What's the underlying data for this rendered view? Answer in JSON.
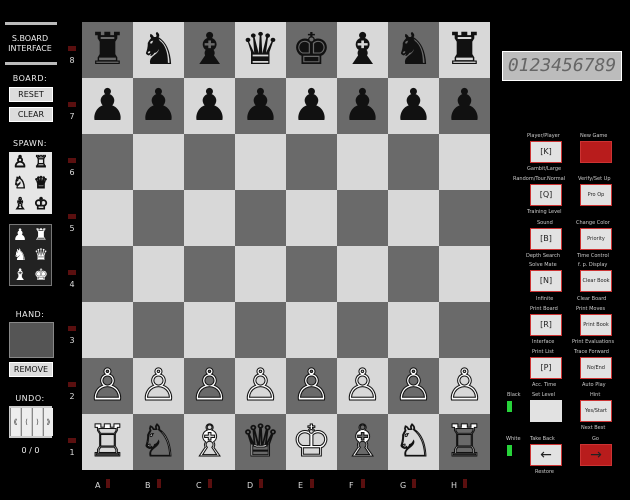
{
  "left_panel": {
    "title_line1": "S.BOARD",
    "title_line2": "INTERFACE",
    "board_label": "BOARD:",
    "reset_label": "RESET",
    "clear_label": "CLEAR",
    "spawn_label": "SPAWN:",
    "spawn_white": [
      "♙",
      "♖",
      "♘",
      "♕",
      "♗",
      "♔"
    ],
    "spawn_black": [
      "♟",
      "♜",
      "♞",
      "♛",
      "♝",
      "♚"
    ],
    "hand_label": "HAND:",
    "remove_label": "REMOVE",
    "undo_label": "UNDO:",
    "undo_buttons": [
      "⟪",
      "⟨",
      "⟩",
      "⟫"
    ],
    "undo_count": "0 / 0"
  },
  "board": {
    "ranks": [
      "8",
      "7",
      "6",
      "5",
      "4",
      "3",
      "2",
      "1"
    ],
    "files": [
      "A",
      "B",
      "C",
      "D",
      "E",
      "F",
      "G",
      "H"
    ],
    "pieces": [
      [
        "♜",
        "♞",
        "♝",
        "♛",
        "♚",
        "♝",
        "♞",
        "♜"
      ],
      [
        "♟",
        "♟",
        "♟",
        "♟",
        "♟",
        "♟",
        "♟",
        "♟"
      ],
      [
        "",
        "",
        "",
        "",
        "",
        "",
        "",
        ""
      ],
      [
        "",
        "",
        "",
        "",
        "",
        "",
        "",
        ""
      ],
      [
        "",
        "",
        "",
        "",
        "",
        "",
        "",
        ""
      ],
      [
        "",
        "",
        "",
        "",
        "",
        "",
        "",
        ""
      ],
      [
        "♙",
        "♙",
        "♙",
        "♙",
        "♙",
        "♙",
        "♙",
        "♙"
      ],
      [
        "♖",
        "♘",
        "♗",
        "♕",
        "♔",
        "♗",
        "♘",
        "♖"
      ]
    ]
  },
  "right_panel": {
    "display": "0123456789",
    "labels": {
      "player_player": "Player/Player",
      "new_game": "New Game",
      "gambit_large": "Gambit/Large",
      "random_tour": "Random/Tour.Normal",
      "verify_setup": "Verify/Set Up",
      "training_level": "Training Level",
      "sound": "Sound",
      "change_color": "Change Color",
      "depth_search": "Depth Search",
      "time_control": "Time Control",
      "solve_mate": "Solve Mate",
      "fp_display": "f. p. Display",
      "infinite": "Infinite",
      "clear_board": "Clear Board",
      "print_board": "Print Board",
      "print_moves": "Print Moves",
      "interface": "Interface",
      "print_evaluations": "Print Evaluations",
      "print_list": "Print List",
      "trace_forward": "Trace Forward",
      "acc_time": "Acc. Time",
      "set_level": "Set Level",
      "auto_play": "Auto Play",
      "hint": "Hint",
      "next_best": "Next Best",
      "black": "Black",
      "white": "White",
      "take_back": "Take Back",
      "go": "Go",
      "restore": "Restore"
    },
    "buttons": {
      "k": "[K]",
      "q": "[Q]",
      "b": "[B]",
      "n": "[N]",
      "r": "[R]",
      "p": "[P]",
      "pro_op": "Pro Op",
      "priority": "Priority",
      "clear_book": "Clear Book",
      "print_book": "Print Book",
      "no_end": "No/End",
      "yes_start": "Yes/Start",
      "take_back_arrow": "←",
      "go_arrow": "→"
    },
    "colors": {
      "new_game": "#b81c1c",
      "go": "#b81c1c",
      "led": "#27d33a"
    }
  }
}
